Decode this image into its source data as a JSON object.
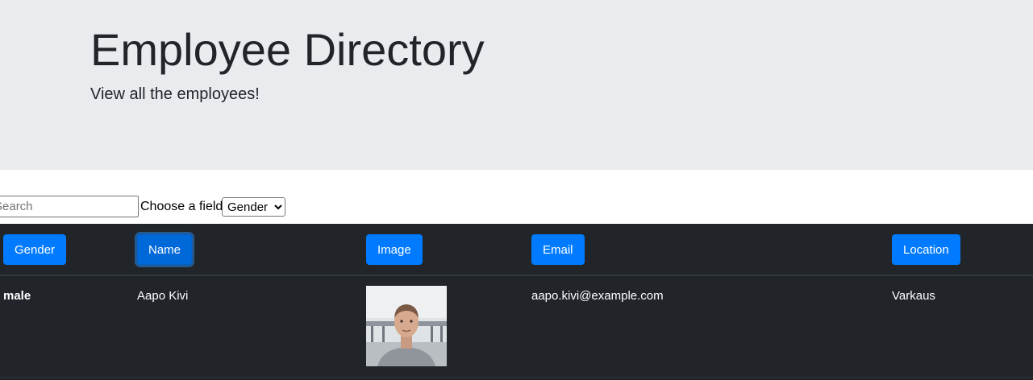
{
  "header": {
    "title": "Employee Directory",
    "lead": "View all the employees!"
  },
  "filters": {
    "search_placeholder": "Search",
    "field_label": "Choose a field:",
    "field_selected": "Gender"
  },
  "table": {
    "columns": [
      "Gender",
      "Name",
      "Image",
      "Email",
      "Location"
    ],
    "rows": [
      {
        "gender": "male",
        "name": "Aapo Kivi",
        "image_icon": "employee-photo",
        "email": "aapo.kivi@example.com",
        "location": "Varkaus"
      }
    ]
  },
  "colors": {
    "jumbotron_bg": "#e9ecef",
    "table_bg": "#212529",
    "button_primary": "#007bff"
  }
}
